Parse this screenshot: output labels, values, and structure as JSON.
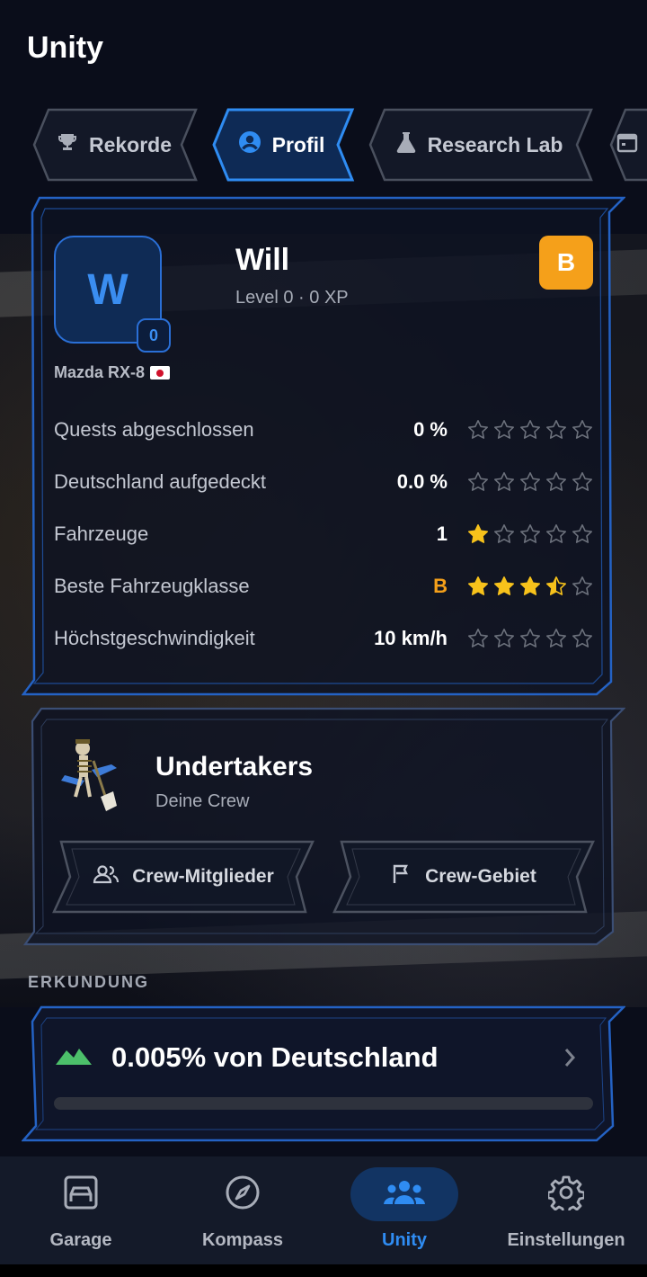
{
  "app": {
    "title": "Unity"
  },
  "tabs": [
    {
      "label": "Rekorde",
      "icon": "trophy-icon",
      "active": false
    },
    {
      "label": "Profil",
      "icon": "user-circle-icon",
      "active": true
    },
    {
      "label": "Research Lab",
      "icon": "flask-icon",
      "active": false
    },
    {
      "label": "",
      "icon": "calendar-icon",
      "active": false
    }
  ],
  "profile": {
    "avatar_letter": "W",
    "avatar_level": "0",
    "name": "Will",
    "level_text": "Level 0 · 0 XP",
    "car": "Mazda RX-8",
    "class_badge": "B",
    "stats": [
      {
        "label": "Quests abgeschlossen",
        "value": "0 %",
        "stars": 0,
        "value_color": "white"
      },
      {
        "label": "Deutschland aufgedeckt",
        "value": "0.0 %",
        "stars": 0,
        "value_color": "white"
      },
      {
        "label": "Fahrzeuge",
        "value": "1",
        "stars": 1,
        "value_color": "white"
      },
      {
        "label": "Beste Fahrzeugklasse",
        "value": "B",
        "stars": 3.5,
        "value_color": "orange"
      },
      {
        "label": "Höchstgeschwindigkeit",
        "value": "10 km/h",
        "stars": 0,
        "value_color": "white"
      }
    ]
  },
  "crew": {
    "name": "Undertakers",
    "subtitle": "Deine Crew",
    "members_label": "Crew-Mitglieder",
    "territory_label": "Crew-Gebiet"
  },
  "exploration": {
    "section_label": "ERKUNDUNG",
    "text": "0.005% von Deutschland",
    "progress": 5e-05
  },
  "nav": [
    {
      "label": "Garage",
      "icon": "garage-icon",
      "active": false
    },
    {
      "label": "Kompass",
      "icon": "compass-icon",
      "active": false
    },
    {
      "label": "Unity",
      "icon": "group-icon",
      "active": true
    },
    {
      "label": "Einstellungen",
      "icon": "gear-icon",
      "active": false
    }
  ],
  "colors": {
    "accent": "#2f8cf2",
    "badge_orange": "#f5a01a",
    "star_gold": "#f7c21b",
    "progress_green": "#4cc06a",
    "background": "#0a0d1a"
  }
}
